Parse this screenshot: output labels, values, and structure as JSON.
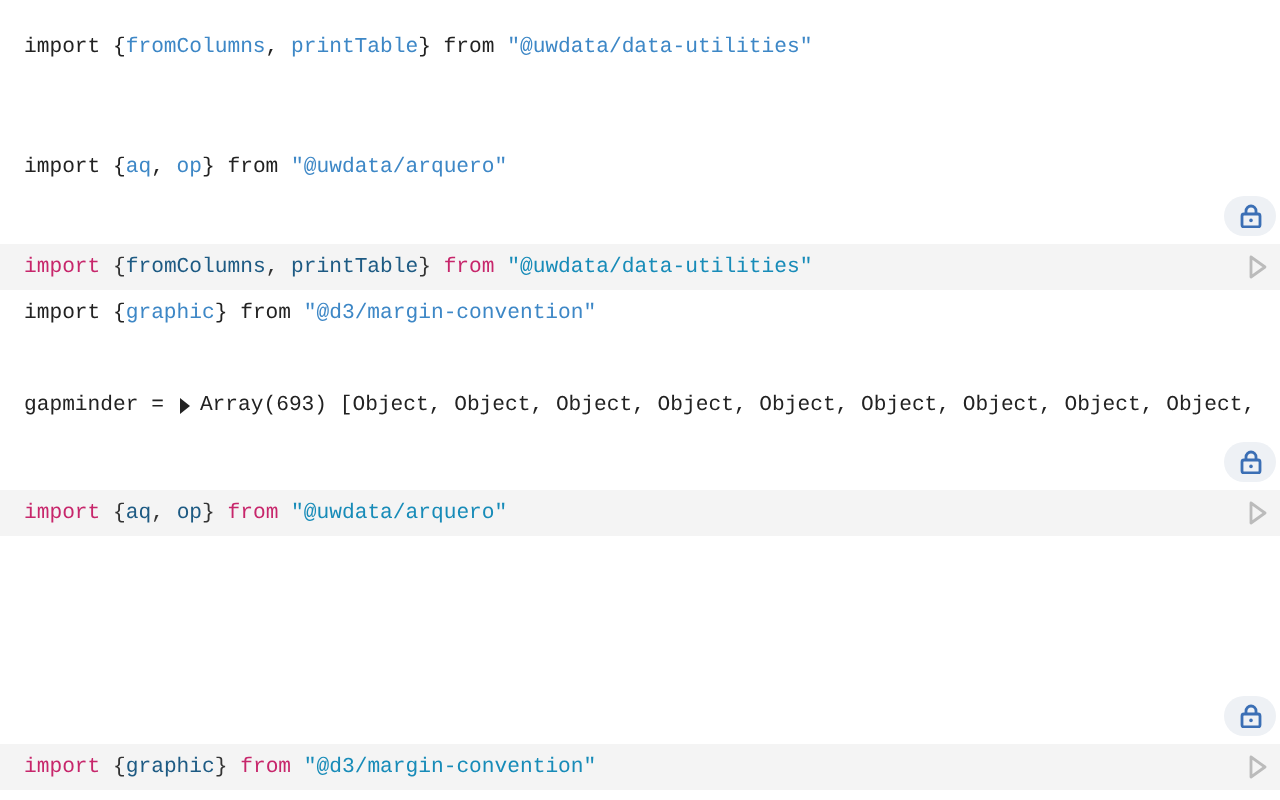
{
  "cells": [
    {
      "kind": "output",
      "tokens": [
        {
          "kind": "plain",
          "text": "import {"
        },
        {
          "kind": "name",
          "text": "fromColumns"
        },
        {
          "kind": "plain",
          "text": ", "
        },
        {
          "kind": "name",
          "text": "printTable"
        },
        {
          "kind": "plain",
          "text": "} from "
        },
        {
          "kind": "string",
          "text": "\"@uwdata/data-utilities\""
        }
      ]
    },
    {
      "kind": "output",
      "tokens": [
        {
          "kind": "plain",
          "text": "import {"
        },
        {
          "kind": "name",
          "text": "aq"
        },
        {
          "kind": "plain",
          "text": ", "
        },
        {
          "kind": "name",
          "text": "op"
        },
        {
          "kind": "plain",
          "text": "} from "
        },
        {
          "kind": "string",
          "text": "\"@uwdata/arquero\""
        }
      ]
    },
    {
      "kind": "editor",
      "pinned": true,
      "tokens": [
        {
          "kind": "keyword",
          "text": "import "
        },
        {
          "kind": "plain",
          "text": "{"
        },
        {
          "kind": "name",
          "text": "fromColumns"
        },
        {
          "kind": "plain",
          "text": ", "
        },
        {
          "kind": "name",
          "text": "printTable"
        },
        {
          "kind": "plain",
          "text": "} "
        },
        {
          "kind": "keyword",
          "text": "from "
        },
        {
          "kind": "string",
          "text": "\"@uwdata/data-utilities\""
        }
      ]
    },
    {
      "kind": "output",
      "tokens": [
        {
          "kind": "plain",
          "text": "import {"
        },
        {
          "kind": "name",
          "text": "graphic"
        },
        {
          "kind": "plain",
          "text": "} from "
        },
        {
          "kind": "string",
          "text": "\"@d3/margin-convention\""
        }
      ]
    },
    {
      "kind": "inspector",
      "name": "gapminder =",
      "expanded": false,
      "value": "Array(693) [Object, Object, Object, Object, Object, Object, Object, Object, Object,"
    },
    {
      "kind": "editor",
      "pinned": true,
      "tokens": [
        {
          "kind": "keyword",
          "text": "import "
        },
        {
          "kind": "plain",
          "text": "{"
        },
        {
          "kind": "name",
          "text": "aq"
        },
        {
          "kind": "plain",
          "text": ", "
        },
        {
          "kind": "name",
          "text": "op"
        },
        {
          "kind": "plain",
          "text": "} "
        },
        {
          "kind": "keyword",
          "text": "from "
        },
        {
          "kind": "string",
          "text": "\"@uwdata/arquero\""
        }
      ]
    },
    {
      "kind": "editor",
      "pinned": true,
      "tokens": [
        {
          "kind": "keyword",
          "text": "import "
        },
        {
          "kind": "plain",
          "text": "{"
        },
        {
          "kind": "name",
          "text": "graphic"
        },
        {
          "kind": "plain",
          "text": "} "
        },
        {
          "kind": "keyword",
          "text": "from "
        },
        {
          "kind": "string",
          "text": "\"@d3/margin-convention\""
        }
      ]
    }
  ]
}
